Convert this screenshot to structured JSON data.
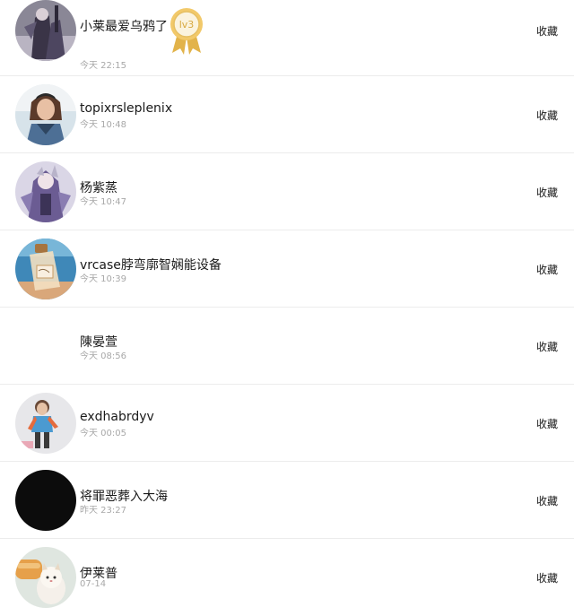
{
  "badge_label": "lv3",
  "items": [
    {
      "name": "小莱最爱乌鸦了",
      "time": "今天 22:15",
      "action": "收藏",
      "avatar": "anime-dark-avatar"
    },
    {
      "name": "topixrsleplenix",
      "time": "今天 10:48",
      "action": "收藏",
      "avatar": "girl-photo-avatar"
    },
    {
      "name": "杨紫蒸",
      "time": "今天 10:47",
      "action": "收藏",
      "avatar": "anime-purple-avatar"
    },
    {
      "name": "vrcase脖弯廓智娴能设备",
      "time": "今天 10:39",
      "action": "收藏",
      "avatar": "bottle-avatar"
    },
    {
      "name": "陳晏萱",
      "time": "今天 08:56",
      "action": "收藏",
      "avatar": "blank-avatar"
    },
    {
      "name": "exdhabrdyv",
      "time": "今天 00:05",
      "action": "收藏",
      "avatar": "kid-photo-avatar"
    },
    {
      "name": "将罪恶葬入大海",
      "time": "昨天 23:27",
      "action": "收藏",
      "avatar": "black-avatar"
    },
    {
      "name": "伊莱普",
      "time": "07-14",
      "action": "收藏",
      "avatar": "cat-avatar"
    }
  ]
}
